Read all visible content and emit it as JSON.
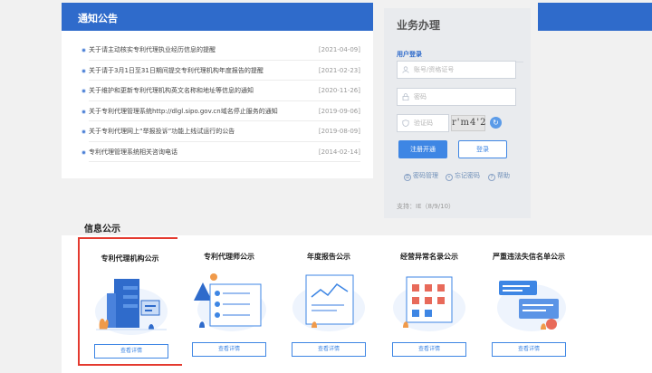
{
  "notice": {
    "header": "通知公告",
    "items": [
      {
        "title": "关于请主动核实专利代理执业经历信息的提醒",
        "date": "[2021-04-09]"
      },
      {
        "title": "关于请于3月1日至31日期间提交专利代理机构年度报告的提醒",
        "date": "[2021-02-23]"
      },
      {
        "title": "关于维护和更新专利代理机构英文名称和地址等信息的通知",
        "date": "[2020-11-26]"
      },
      {
        "title": "关于专利代理管理系统http://dlgl.sipo.gov.cn域名停止服务的通知",
        "date": "[2019-09-06]"
      },
      {
        "title": "关于专利代理网上“举报投诉”功能上线试运行的公告",
        "date": "[2019-08-09]"
      },
      {
        "title": "专利代理管理系统相关咨询电话",
        "date": "[2014-02-14]"
      }
    ]
  },
  "business": {
    "title": "业务办理",
    "login_tab": "用户登录",
    "account_placeholder": "账号/资格证号",
    "password_placeholder": "密码",
    "captcha_placeholder": "验证码",
    "captcha_text": "r'm4'2",
    "register_label": "注册开通",
    "login_label": "登录",
    "links": {
      "change_password": "密码管理",
      "forgot_password": "忘记密码",
      "help": "帮助"
    },
    "support": "支持：IE（8/9/10）"
  },
  "info": {
    "title": "信息公示",
    "cards": [
      {
        "title": "专利代理机构公示",
        "button": "查看详情"
      },
      {
        "title": "专利代理师公示",
        "button": "查看详情"
      },
      {
        "title": "年度报告公示",
        "button": "查看详情"
      },
      {
        "title": "经营异常名录公示",
        "button": "查看详情"
      },
      {
        "title": "严重违法失信名单公示",
        "button": "查看详情"
      }
    ]
  },
  "colors": {
    "brand_blue": "#2f6bcb",
    "selected_border": "#e43a2f"
  }
}
